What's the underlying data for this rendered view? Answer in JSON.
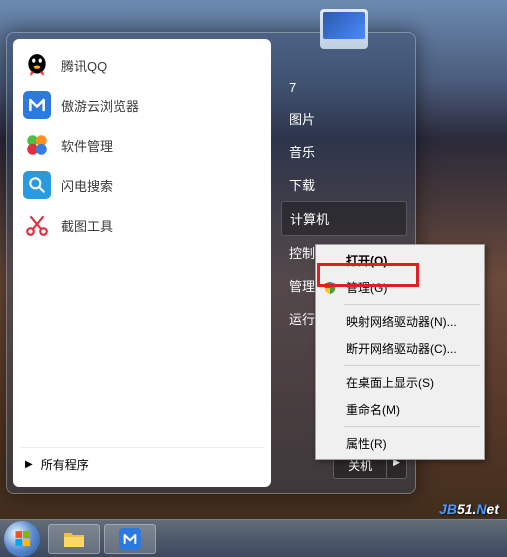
{
  "user_label": "7",
  "left_apps": [
    {
      "label": "腾讯QQ",
      "icon": "qq"
    },
    {
      "label": "傲游云浏览器",
      "icon": "maxthon"
    },
    {
      "label": "软件管理",
      "icon": "colorball"
    },
    {
      "label": "闪电搜索",
      "icon": "search"
    },
    {
      "label": "截图工具",
      "icon": "scissors"
    }
  ],
  "all_programs": "所有程序",
  "right_items": [
    {
      "label": "7",
      "type": "item"
    },
    {
      "label": "图片",
      "type": "item"
    },
    {
      "label": "音乐",
      "type": "item"
    },
    {
      "label": "下载",
      "type": "item"
    },
    {
      "label": "计算机",
      "type": "highlighted"
    },
    {
      "label": "控制",
      "type": "item"
    },
    {
      "label": "管理",
      "type": "item"
    },
    {
      "label": "运行",
      "type": "item"
    }
  ],
  "shutdown": {
    "label": "关机"
  },
  "context_menu": [
    {
      "label": "打开(O)",
      "bold": true
    },
    {
      "label": "管理(G)",
      "shield": true
    },
    {
      "type": "sep"
    },
    {
      "label": "映射网络驱动器(N)..."
    },
    {
      "label": "断开网络驱动器(C)..."
    },
    {
      "type": "sep"
    },
    {
      "label": "在桌面上显示(S)"
    },
    {
      "label": "重命名(M)"
    },
    {
      "type": "sep"
    },
    {
      "label": "属性(R)"
    }
  ],
  "watermark": "JB51.Net"
}
